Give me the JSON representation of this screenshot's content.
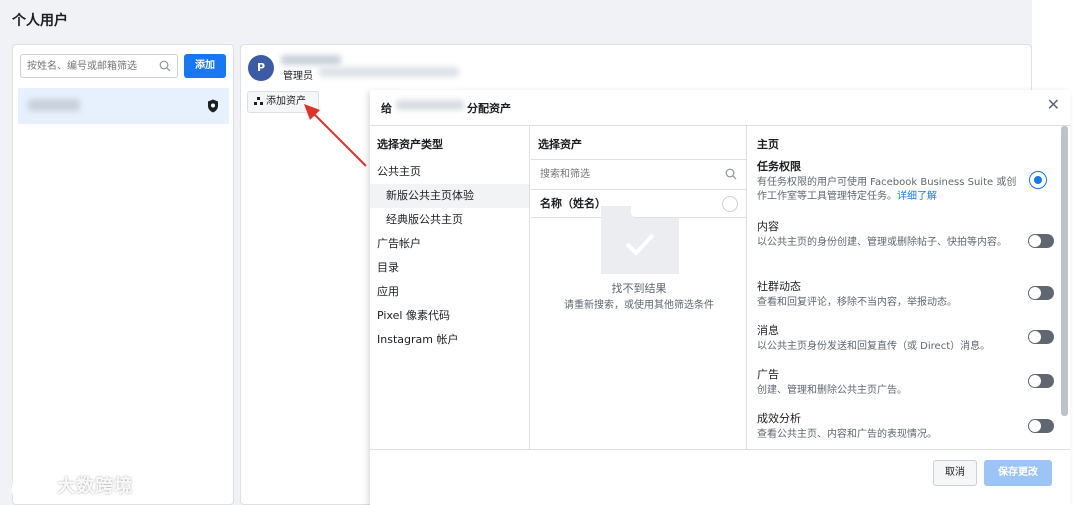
{
  "page": {
    "title": "个人用户"
  },
  "users_panel": {
    "search_placeholder": "按姓名、编号或邮箱筛选",
    "add_label": "添加",
    "shield_icon": "shield-icon"
  },
  "user_detail": {
    "avatar_letter": "P",
    "role": "管理员",
    "add_asset_label": "添加资产"
  },
  "dialog": {
    "title_prefix": "给",
    "title_suffix": "分配资产",
    "close_icon": "close-icon",
    "col1": {
      "header": "选择资产类型",
      "items": [
        {
          "label": "公共主页"
        },
        {
          "label": "新版公共主页体验"
        },
        {
          "label": "经典版公共主页"
        },
        {
          "label": "广告帐户"
        },
        {
          "label": "目录"
        },
        {
          "label": "应用"
        },
        {
          "label": "Pixel 像素代码"
        },
        {
          "label": "Instagram 帐户"
        }
      ]
    },
    "col2": {
      "header": "选择资产",
      "search_placeholder": "搜索和筛选",
      "name_column": "名称（姓名）",
      "empty_title": "找不到结果",
      "empty_sub": "请重新搜索，或使用其他筛选条件"
    },
    "col3": {
      "header": "主页",
      "perms": [
        {
          "title": "任务权限",
          "desc": "有任务权限的用户可使用 Facebook Business Suite 或创作工作室等工具管理特定任务。",
          "link": "详细了解",
          "enabled": true
        },
        {
          "title": "内容",
          "desc": "以公共主页的身份创建、管理或删除帖子、快拍等内容。",
          "enabled": false
        },
        {
          "title": "社群动态",
          "desc": "查看和回复评论，移除不当内容，举报动态。",
          "enabled": false
        },
        {
          "title": "消息",
          "desc": "以公共主页身份发送和回复直传（或 Direct）消息。",
          "enabled": false
        },
        {
          "title": "广告",
          "desc": "创建、管理和删除公共主页广告。",
          "enabled": false
        },
        {
          "title": "成效分析",
          "desc": "查看公共主页、内容和广告的表现情况。",
          "enabled": false
        }
      ]
    },
    "cancel_label": "取消",
    "save_label": "保存更改"
  },
  "watermark": {
    "text": "大数跨境"
  },
  "colors": {
    "accent": "#1877f2",
    "arrow": "#e0312a",
    "selected_row": "#e7f0fd"
  }
}
